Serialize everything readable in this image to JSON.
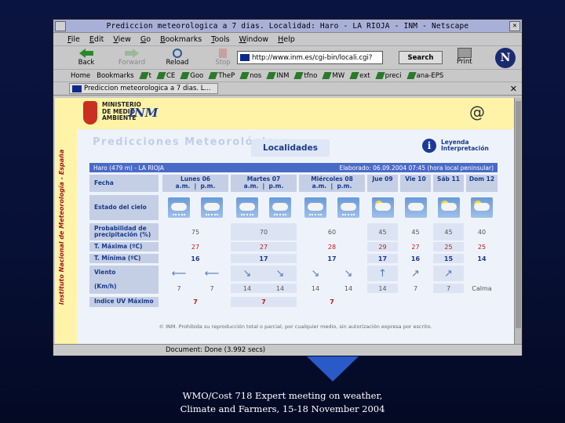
{
  "window": {
    "title": "Prediccion meteorologica a 7 dias. Localidad: Haro - LA RIOJA - INM - Netscape"
  },
  "menu": [
    "File",
    "Edit",
    "View",
    "Go",
    "Bookmarks",
    "Tools",
    "Window",
    "Help"
  ],
  "nav": {
    "back": "Back",
    "forward": "Forward",
    "reload": "Reload",
    "stop": "Stop",
    "url": "http://www.inm.es/cgi-bin/locali.cgi?",
    "search": "Search",
    "print": "Print",
    "logo": "N"
  },
  "bookmarks": [
    "Home",
    "Bookmarks",
    "t",
    "CE",
    "Goo",
    "TheP",
    "nos",
    "INM",
    "tfno",
    "MW",
    "ext",
    "preci",
    "ana-EPS"
  ],
  "tab": {
    "title": "Prediccion meteorologica a 7 dias. L..."
  },
  "page": {
    "vertical_label": "Instituto Nacional de Meteorología - España",
    "ministerio": [
      "MINISTERIO",
      "DE MEDIO",
      "AMBIENTE"
    ],
    "inm_logo": "INM",
    "at_icon": "@",
    "heading_ghost": "Predicciones Meteorológicas",
    "localidades": "Localidades",
    "leyenda": [
      "Leyenda",
      "Interpretación"
    ],
    "location": "Haro (479 m) - LA RIOJA",
    "elaborado": "Elaborado: 06.09.2004 07:45 (hora local peninsular)",
    "labels": {
      "fecha": "Fecha",
      "estado": "Estado del cielo",
      "prob": "Probabilidad de precipitación (%)",
      "tmax": "T. Máxima (ºC)",
      "tmin": "T. Mínima (ºC)",
      "viento": "Viento",
      "kmh": "(Km/h)",
      "uv": "Indice UV Máximo"
    },
    "days": [
      {
        "name": "Lunes 06",
        "am": "a.m.",
        "pm": "p.m."
      },
      {
        "name": "Martes 07",
        "am": "a.m.",
        "pm": "p.m."
      },
      {
        "name": "Miércoles 08",
        "am": "a.m.",
        "pm": "p.m."
      },
      {
        "name": "Jue 09"
      },
      {
        "name": "Vie 10"
      },
      {
        "name": "Sáb 11"
      },
      {
        "name": "Dom 12"
      }
    ],
    "prob": [
      "75",
      "70",
      "60",
      "45",
      "45",
      "45",
      "40"
    ],
    "tmax": [
      "27",
      "27",
      "28",
      "29",
      "27",
      "25",
      "25"
    ],
    "tmin": [
      "16",
      "17",
      "17",
      "17",
      "16",
      "15",
      "14"
    ],
    "wind_speeds": [
      "7",
      "7",
      "14",
      "14",
      "14",
      "14",
      "14",
      "7",
      "7",
      "Calma"
    ],
    "uv": [
      "7",
      "7",
      "7"
    ],
    "copyright": "© INM. Prohibida su reproducción total o parcial, por cualquier medio, sin autorización expresa por escrito."
  },
  "status": {
    "text": "Document: Done (3.992 secs)"
  },
  "caption": "WMO/Cost 718 Expert meeting on weather, Climate and Farmers, 15-18 November 2004"
}
